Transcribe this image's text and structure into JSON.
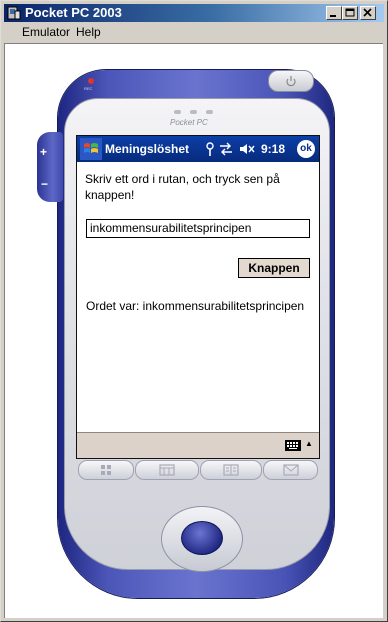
{
  "window": {
    "title": "Pocket PC 2003",
    "menu": [
      "Emulator",
      "Help"
    ]
  },
  "device": {
    "brand": "Pocket PC",
    "rec_label": "REC"
  },
  "navbar": {
    "title": "Meningslöshet",
    "time": "9:18",
    "ok_label": "ok"
  },
  "content": {
    "instruction": "Skriv ett ord i rutan, och tryck sen på knappen!",
    "textbox_value": "inkommensurabilitetsprincipen",
    "button_label": "Knappen",
    "result_text": "Ordet var: inkommensurabilitetsprincipen"
  },
  "icons": {
    "start": "windows-flag-icon",
    "connectivity": "antenna-icon",
    "sync": "sync-arrows-icon",
    "volume": "speaker-muted-icon",
    "keyboard": "keyboard-icon"
  },
  "colors": {
    "titlebar_start": "#0a246a",
    "navbar": "#0c3fa8",
    "device_body": "#4c56b8",
    "button_face": "#e4d9cf",
    "menu_bar": "#ddd2c9"
  }
}
